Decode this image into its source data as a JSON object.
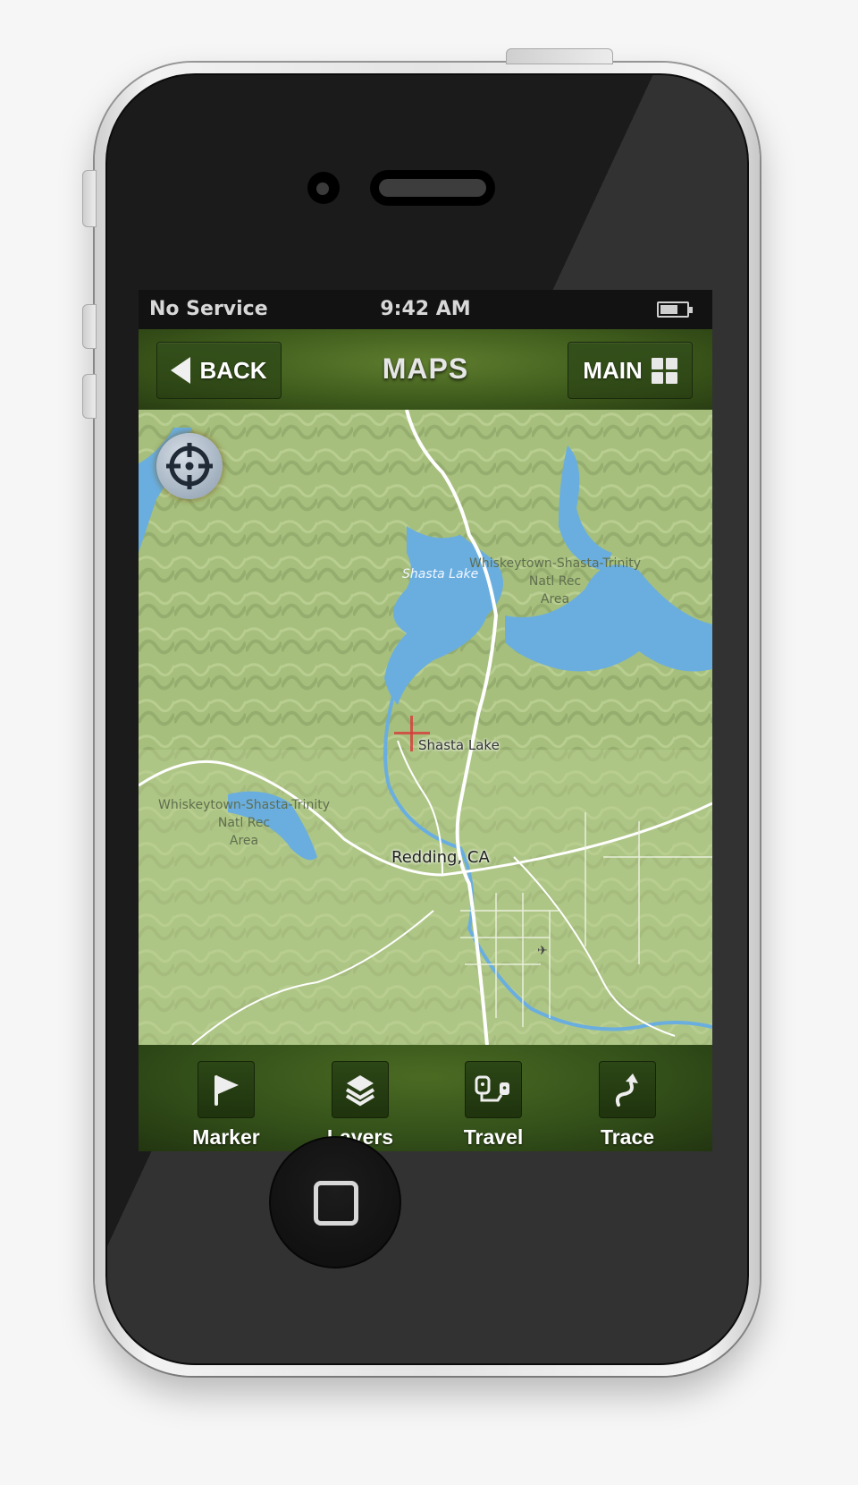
{
  "status_bar": {
    "carrier": "No Service",
    "time": "9:42 AM",
    "battery_icon": "battery-icon"
  },
  "nav_bar": {
    "back_label": "BACK",
    "title": "MAPS",
    "main_label": "MAIN",
    "back_icon": "back-arrow-icon",
    "main_icon": "grid-icon"
  },
  "map": {
    "locate_icon": "crosshair-target-icon",
    "labels": {
      "lake": "Shasta Lake",
      "park_ne": [
        "Whiskeytown-Shasta-Trinity",
        "Natl Rec",
        "Area"
      ],
      "park_w": [
        "Whiskeytown-Shasta-Trinity",
        "Natl Rec",
        "Area"
      ],
      "city_shasta_lake": "Shasta Lake",
      "city_redding": "Redding, CA"
    },
    "colors": {
      "water": "#6aaee0",
      "terrain": "#a9c27f",
      "roads": "#ffffff",
      "crosshair": "#d63b3b"
    }
  },
  "toolbar": {
    "items": [
      {
        "label": "Marker",
        "icon": "flag-icon"
      },
      {
        "label": "Layers",
        "icon": "layers-icon"
      },
      {
        "label": "Travel",
        "icon": "travel-route-icon"
      },
      {
        "label": "Trace",
        "icon": "trace-path-icon"
      }
    ]
  },
  "theme": {
    "accent_green": "#3e5b1c",
    "status_bar_bg": "#121212"
  }
}
